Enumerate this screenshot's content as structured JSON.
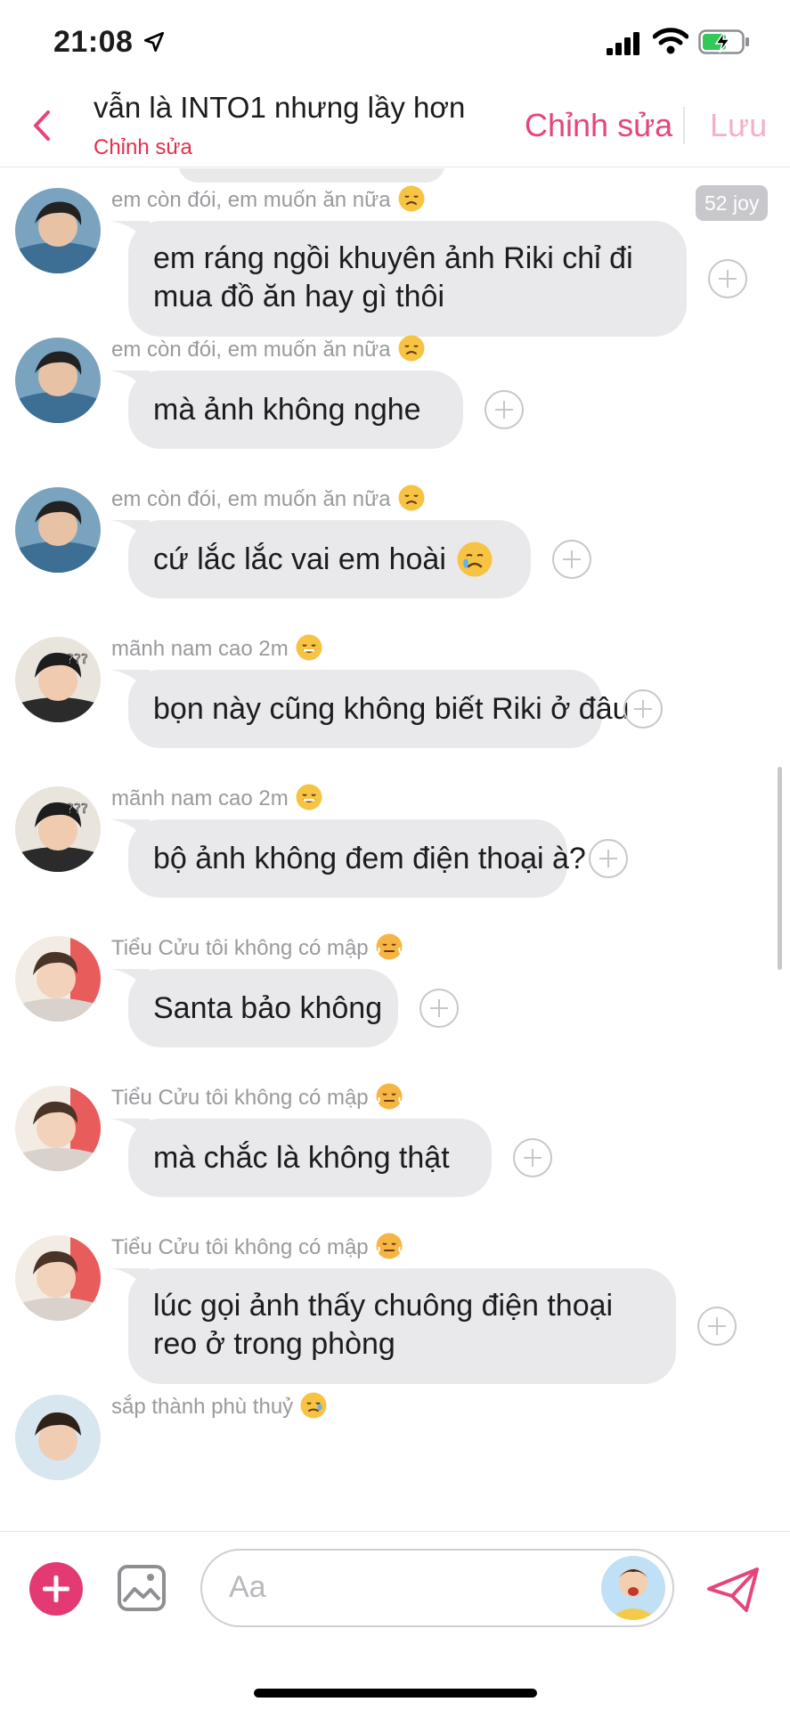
{
  "status_bar": {
    "time": "21:08",
    "icons": [
      "location-arrow-icon",
      "signal-icon",
      "wifi-icon",
      "battery-charging-icon"
    ]
  },
  "header": {
    "title": "vẫn là INTO1 nhưng lầy hơn",
    "subtitle": "Chỉnh sửa",
    "edit_label": "Chỉnh sửa",
    "save_label": "Lưu",
    "accent_color": "#e6457a"
  },
  "badge": {
    "text": "52 joy"
  },
  "messages": [
    {
      "sender": "em còn đói, em muốn ăn nữa",
      "emoji": "disappointed-face",
      "time": "",
      "lines": [
        "em ráng ngồi khuyên ảnh Riki chỉ đi",
        "mua đồ ăn hay gì thôi"
      ]
    },
    {
      "sender": "em còn đói, em muốn ăn nữa",
      "emoji": "disappointed-face",
      "time": "",
      "lines": [
        "mà ảnh không nghe"
      ]
    },
    {
      "sender": "em còn đói, em muốn ăn nữa",
      "emoji": "disappointed-face",
      "time": "",
      "lines": [
        "cứ lắc lắc vai em hoài"
      ],
      "inline_emoji": "crying-face"
    },
    {
      "sender": "mãnh nam cao",
      "emoji": "grinning-face",
      "time": "2m",
      "lines": [
        "bọn này cũng không biết Riki ở đâu"
      ]
    },
    {
      "sender": "mãnh nam cao",
      "emoji": "grinning-face",
      "time": "2m",
      "lines": [
        "bộ ảnh không đem điện thoại à?"
      ]
    },
    {
      "sender": "Tiểu Cửu tôi không có mập",
      "emoji": "steam-face",
      "time": "",
      "lines": [
        "Santa bảo không"
      ]
    },
    {
      "sender": "Tiểu Cửu tôi không có mập",
      "emoji": "steam-face",
      "time": "",
      "lines": [
        "mà chắc là không thật"
      ]
    },
    {
      "sender": "Tiểu Cửu tôi không có mập",
      "emoji": "steam-face",
      "time": "",
      "lines": [
        "lúc gọi ảnh thấy chuông điện thoại",
        "reo ở trong phòng"
      ]
    },
    {
      "sender": "sắp thành phù thuỷ",
      "emoji": "tearful-face",
      "time": "",
      "lines": []
    }
  ],
  "input": {
    "placeholder": "Aa"
  },
  "bottom_icons": [
    "add-icon",
    "image-icon",
    "send-icon"
  ]
}
